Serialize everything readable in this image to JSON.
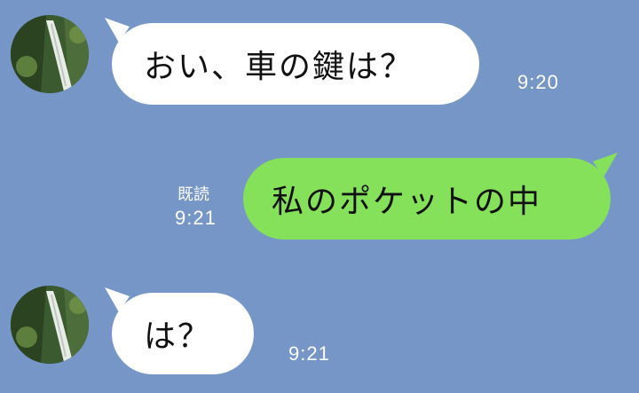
{
  "chat": {
    "messages": [
      {
        "side": "incoming",
        "text": "おい、車の鍵は？",
        "time": "9:20"
      },
      {
        "side": "outgoing",
        "text": "私のポケットの中",
        "read_label": "既読",
        "time": "9:21"
      },
      {
        "side": "incoming",
        "text": "は？",
        "time": "9:21"
      }
    ]
  },
  "colors": {
    "background": "#7596c6",
    "incoming_bubble": "#ffffff",
    "outgoing_bubble": "#85e05a",
    "timestamp": "#ffffff"
  },
  "icons": {
    "avatar": "waterfall-avatar"
  }
}
